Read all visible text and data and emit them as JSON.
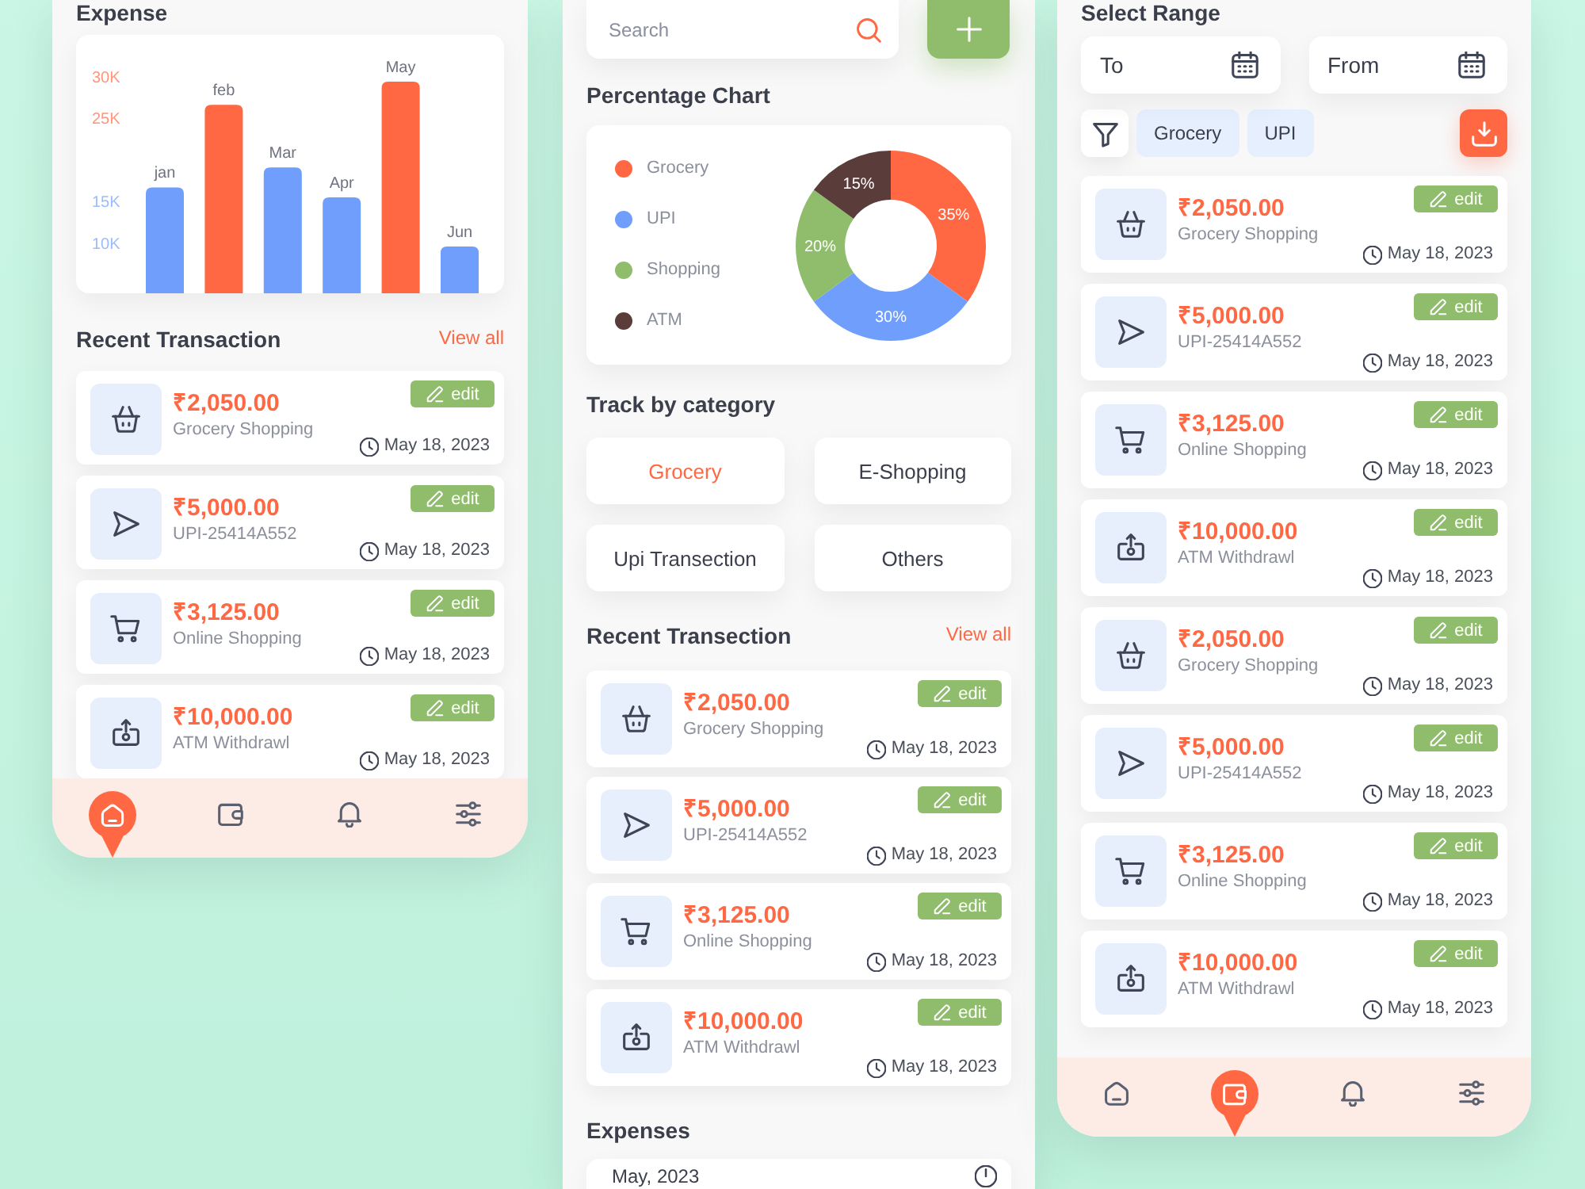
{
  "left_phone": {
    "expense": {
      "title": "Expense",
      "chart_data": {
        "type": "bar",
        "categories": [
          "jan",
          "feb",
          "Mar",
          "Apr",
          "May",
          "Jun"
        ],
        "values": [
          16700,
          26600,
          19100,
          15500,
          29400,
          9600
        ],
        "colors": [
          "#6f9efc",
          "#ff6843",
          "#6f9efc",
          "#6f9efc",
          "#ff6843",
          "#6f9efc"
        ],
        "ylim": [
          4000,
          35000
        ],
        "yticks": [
          {
            "value": 30000,
            "label": "30K"
          },
          {
            "value": 25000,
            "label": "25K"
          },
          {
            "value": 15000,
            "label": "15K"
          },
          {
            "value": 10000,
            "label": "10K"
          }
        ]
      }
    },
    "recent": {
      "title": "Recent Transaction",
      "link": "View all",
      "transactions": [
        {
          "kind": "grocery",
          "amount": "₹2,050.00",
          "description": "Grocery Shopping",
          "date": "May 18, 2023",
          "action": "edit"
        },
        {
          "kind": "transfer",
          "amount": "₹5,000.00",
          "description": "UPI-25414A552",
          "date": "May 18, 2023",
          "action": "edit"
        },
        {
          "kind": "shopping",
          "amount": "₹3,125.00",
          "description": "Online Shopping",
          "date": "May 18, 2023",
          "action": "edit"
        },
        {
          "kind": "withdrawal",
          "amount": "₹10,000.00",
          "description": "ATM Withdrawl",
          "date": "May 18, 2023",
          "action": "edit"
        }
      ]
    },
    "nav": [
      {
        "selected": true
      },
      {
        "selected": false
      },
      {
        "selected": false
      },
      {
        "selected": false
      }
    ]
  },
  "middle_phone": {
    "search": {
      "placeholder": "Search"
    },
    "percentage_chart": {
      "title": "Percentage Chart",
      "chart_data": {
        "type": "donut",
        "categories": [
          "Grocery",
          "UPI",
          "Shopping",
          "ATM"
        ],
        "values": [
          35,
          30,
          20,
          15
        ],
        "colors": [
          "#ff6843",
          "#6f9efc",
          "#8fbd6b",
          "#5a3d3b"
        ],
        "value_labels": [
          "35%",
          "30%",
          "20%",
          "15%"
        ],
        "legend": "left"
      }
    },
    "categories": {
      "title": "Track by category",
      "items": [
        {
          "label": "Grocery",
          "selected": true
        },
        {
          "label": "E-Shopping",
          "selected": false
        },
        {
          "label": "Upi Transection",
          "selected": false
        },
        {
          "label": "Others",
          "selected": false
        }
      ]
    },
    "recent": {
      "title": "Recent Transection",
      "link": "View all",
      "transactions": [
        {
          "kind": "grocery",
          "amount": "₹2,050.00",
          "description": "Grocery Shopping",
          "date": "May 18, 2023",
          "action": "edit"
        },
        {
          "kind": "transfer",
          "amount": "₹5,000.00",
          "description": "UPI-25414A552",
          "date": "May 18, 2023",
          "action": "edit"
        },
        {
          "kind": "shopping",
          "amount": "₹3,125.00",
          "description": "Online Shopping",
          "date": "May 18, 2023",
          "action": "edit"
        },
        {
          "kind": "withdrawal",
          "amount": "₹10,000.00",
          "description": "ATM Withdrawl",
          "date": "May 18, 2023",
          "action": "edit"
        }
      ]
    },
    "expenses": {
      "title": "Expenses",
      "month": "May, 2023"
    }
  },
  "right_phone": {
    "title": "Select Range",
    "date_fields": [
      {
        "placeholder": "To"
      },
      {
        "placeholder": "From"
      }
    ],
    "filter_chips": [
      "Grocery",
      "UPI"
    ],
    "transactions": [
      {
        "kind": "grocery",
        "amount": "₹2,050.00",
        "description": "Grocery Shopping",
        "date": "May 18, 2023",
        "action": "edit"
      },
      {
        "kind": "transfer",
        "amount": "₹5,000.00",
        "description": "UPI-25414A552",
        "date": "May 18, 2023",
        "action": "edit"
      },
      {
        "kind": "shopping",
        "amount": "₹3,125.00",
        "description": "Online Shopping",
        "date": "May 18, 2023",
        "action": "edit"
      },
      {
        "kind": "withdrawal",
        "amount": "₹10,000.00",
        "description": "ATM Withdrawl",
        "date": "May 18, 2023",
        "action": "edit"
      },
      {
        "kind": "grocery",
        "amount": "₹2,050.00",
        "description": "Grocery Shopping",
        "date": "May 18, 2023",
        "action": "edit"
      },
      {
        "kind": "transfer",
        "amount": "₹5,000.00",
        "description": "UPI-25414A552",
        "date": "May 18, 2023",
        "action": "edit"
      },
      {
        "kind": "shopping",
        "amount": "₹3,125.00",
        "description": "Online Shopping",
        "date": "May 18, 2023",
        "action": "edit"
      },
      {
        "kind": "withdrawal",
        "amount": "₹10,000.00",
        "description": "ATM Withdrawl",
        "date": "May 18, 2023",
        "action": "edit"
      }
    ],
    "nav": [
      {
        "selected": false
      },
      {
        "selected": true
      },
      {
        "selected": false
      },
      {
        "selected": false
      }
    ]
  }
}
